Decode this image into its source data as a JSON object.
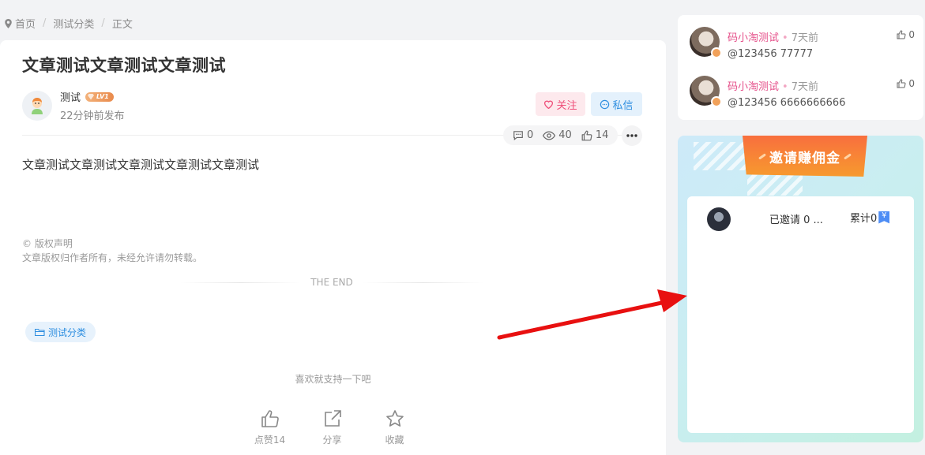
{
  "breadcrumb": {
    "home": "首页",
    "category": "测试分类",
    "current": "正文"
  },
  "article": {
    "title": "文章测试文章测试文章测试",
    "author": {
      "name": "测试",
      "level": "LV1",
      "time": "22分钟前发布"
    },
    "follow_label": "关注",
    "message_label": "私信",
    "stats": {
      "comments": "0",
      "views": "40",
      "likes": "14"
    },
    "content": "文章测试文章测试文章测试文章测试文章测试",
    "copyright_title": "© 版权声明",
    "copyright_text": "文章版权归作者所有，未经允许请勿转载。",
    "the_end": "THE END",
    "tag": "测试分类",
    "support_text": "喜欢就支持一下吧",
    "actions": [
      {
        "label": "点赞14",
        "icon": "thumbs-up-icon"
      },
      {
        "label": "分享",
        "icon": "share-icon"
      },
      {
        "label": "收藏",
        "icon": "star-icon"
      }
    ]
  },
  "comments": [
    {
      "name": "码小淘测试",
      "time": "7天前",
      "likes": "0",
      "text": "@123456 77777"
    },
    {
      "name": "码小淘测试",
      "time": "7天前",
      "likes": "0",
      "text": "@123456 6666666666"
    }
  ],
  "invite": {
    "title": "邀请赚佣金",
    "invited": "已邀请 0 ...",
    "total": "累计0",
    "currency_icon": "yen-icon"
  },
  "colors": {
    "accent_pink": "#ef4f7a",
    "accent_blue": "#2f8fe0",
    "arrow": "#e81010"
  }
}
